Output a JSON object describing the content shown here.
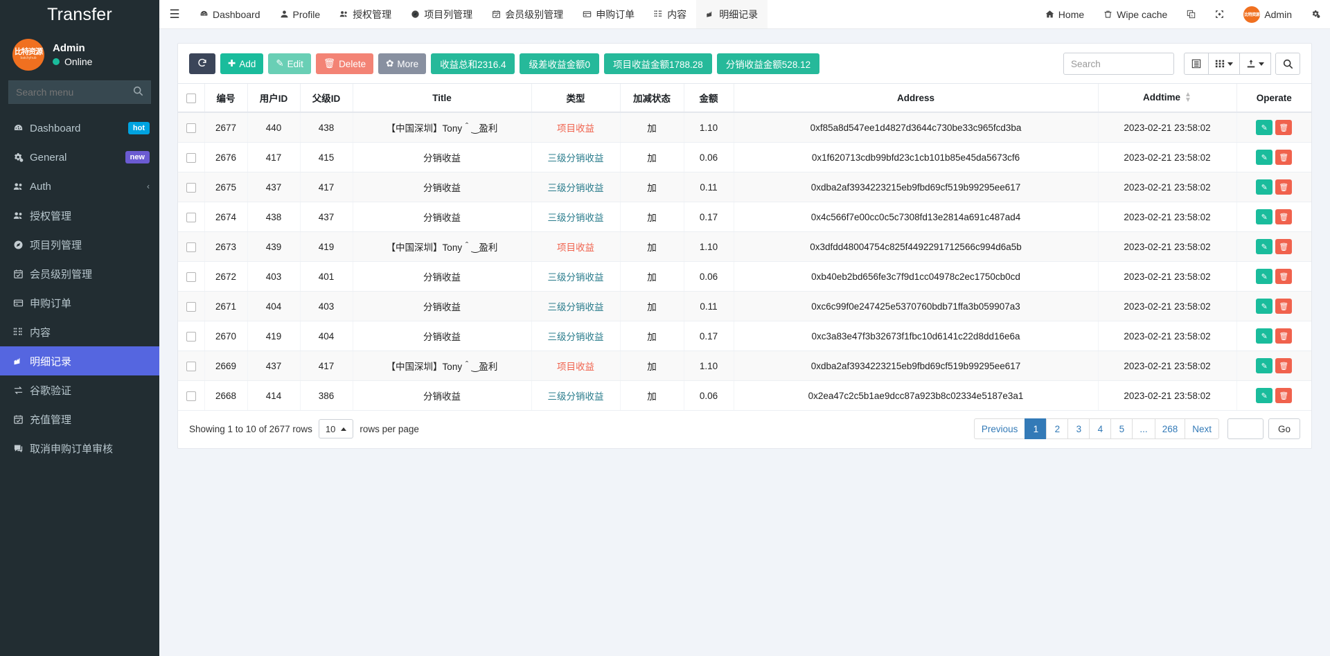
{
  "sidebar": {
    "brand": "Transfer",
    "user": {
      "name": "Admin",
      "status": "Online",
      "avatar_cn": "比特资源",
      "avatar_sub": "batchyhub"
    },
    "search_placeholder": "Search menu",
    "items": [
      {
        "label": "Dashboard",
        "icon": "dashboard-icon",
        "badge": "hot",
        "badge_type": "hot"
      },
      {
        "label": "General",
        "icon": "gears-icon",
        "badge": "new",
        "badge_type": "new"
      },
      {
        "label": "Auth",
        "icon": "users-icon",
        "chevron": "‹"
      },
      {
        "label": "授权管理",
        "icon": "users-icon"
      },
      {
        "label": "项目列管理",
        "icon": "compass-icon"
      },
      {
        "label": "会员级别管理",
        "icon": "calendar-check-icon"
      },
      {
        "label": "申购订单",
        "icon": "card-icon"
      },
      {
        "label": "内容",
        "icon": "th-icon"
      },
      {
        "label": "明细记录",
        "icon": "chart-icon",
        "active": true
      },
      {
        "label": "谷歌验证",
        "icon": "exchange-icon"
      },
      {
        "label": "充值管理",
        "icon": "calendar-check-icon"
      },
      {
        "label": "取消申购订单审核",
        "icon": "comment-icon"
      }
    ]
  },
  "topnav": {
    "hamburger": "☰",
    "left_items": [
      {
        "label": "Dashboard",
        "icon": "dashboard-icon"
      },
      {
        "label": "Profile",
        "icon": "user-icon"
      },
      {
        "label": "授权管理",
        "icon": "users-icon"
      },
      {
        "label": "项目列管理",
        "icon": "compass-icon"
      },
      {
        "label": "会员级别管理",
        "icon": "calendar-check-icon"
      },
      {
        "label": "申购订单",
        "icon": "card-icon"
      },
      {
        "label": "内容",
        "icon": "th-icon"
      },
      {
        "label": "明细记录",
        "icon": "chart-icon",
        "active": true
      }
    ],
    "right_items": [
      {
        "label": "Home",
        "icon": "home-icon"
      },
      {
        "label": "Wipe cache",
        "icon": "trash-icon"
      },
      {
        "label": "",
        "icon": "language-icon"
      },
      {
        "label": "",
        "icon": "fullscreen-icon"
      },
      {
        "label": "Admin",
        "icon": "avatar-icon"
      },
      {
        "label": "",
        "icon": "gear-icon"
      }
    ]
  },
  "toolbar": {
    "refresh_label": "↻",
    "add_label": "Add",
    "edit_label": "Edit",
    "delete_label": "Delete",
    "more_label": "More",
    "stats": [
      "收益总和2316.4",
      "级差收益金额0",
      "项目收益金额1788.28",
      "分销收益金额528.12"
    ],
    "search_placeholder": "Search",
    "columns_icon": "columns-icon",
    "grid_icon": "grid-icon",
    "export_icon": "export-icon",
    "search_icon": "search-icon"
  },
  "table": {
    "columns": [
      "",
      "编号",
      "用户ID",
      "父级ID",
      "Title",
      "类型",
      "加减状态",
      "金额",
      "Address",
      "Addtime",
      "Operate"
    ],
    "rows": [
      {
        "id": "2677",
        "uid": "440",
        "pid": "438",
        "title": "【中国深圳】Tony＾‿盈利",
        "type": "项目收益",
        "type_color": "red",
        "sign": "加",
        "amount": "1.10",
        "address": "0xf85a8d547ee1d4827d3644c730be33c965fcd3ba",
        "addtime": "2023-02-21 23:58:02"
      },
      {
        "id": "2676",
        "uid": "417",
        "pid": "415",
        "title": "分销收益",
        "type": "三级分销收益",
        "type_color": "teal",
        "sign": "加",
        "amount": "0.06",
        "address": "0x1f620713cdb99bfd23c1cb101b85e45da5673cf6",
        "addtime": "2023-02-21 23:58:02"
      },
      {
        "id": "2675",
        "uid": "437",
        "pid": "417",
        "title": "分销收益",
        "type": "三级分销收益",
        "type_color": "teal",
        "sign": "加",
        "amount": "0.11",
        "address": "0xdba2af3934223215eb9fbd69cf519b99295ee617",
        "addtime": "2023-02-21 23:58:02"
      },
      {
        "id": "2674",
        "uid": "438",
        "pid": "437",
        "title": "分销收益",
        "type": "三级分销收益",
        "type_color": "teal",
        "sign": "加",
        "amount": "0.17",
        "address": "0x4c566f7e00cc0c5c7308fd13e2814a691c487ad4",
        "addtime": "2023-02-21 23:58:02"
      },
      {
        "id": "2673",
        "uid": "439",
        "pid": "419",
        "title": "【中国深圳】Tony＾‿盈利",
        "type": "项目收益",
        "type_color": "red",
        "sign": "加",
        "amount": "1.10",
        "address": "0x3dfdd48004754c825f4492291712566c994d6a5b",
        "addtime": "2023-02-21 23:58:02"
      },
      {
        "id": "2672",
        "uid": "403",
        "pid": "401",
        "title": "分销收益",
        "type": "三级分销收益",
        "type_color": "teal",
        "sign": "加",
        "amount": "0.06",
        "address": "0xb40eb2bd656fe3c7f9d1cc04978c2ec1750cb0cd",
        "addtime": "2023-02-21 23:58:02"
      },
      {
        "id": "2671",
        "uid": "404",
        "pid": "403",
        "title": "分销收益",
        "type": "三级分销收益",
        "type_color": "teal",
        "sign": "加",
        "amount": "0.11",
        "address": "0xc6c99f0e247425e5370760bdb71ffa3b059907a3",
        "addtime": "2023-02-21 23:58:02"
      },
      {
        "id": "2670",
        "uid": "419",
        "pid": "404",
        "title": "分销收益",
        "type": "三级分销收益",
        "type_color": "teal",
        "sign": "加",
        "amount": "0.17",
        "address": "0xc3a83e47f3b32673f1fbc10d6141c22d8dd16e6a",
        "addtime": "2023-02-21 23:58:02"
      },
      {
        "id": "2669",
        "uid": "437",
        "pid": "417",
        "title": "【中国深圳】Tony＾‿盈利",
        "type": "项目收益",
        "type_color": "red",
        "sign": "加",
        "amount": "1.10",
        "address": "0xdba2af3934223215eb9fbd69cf519b99295ee617",
        "addtime": "2023-02-21 23:58:02"
      },
      {
        "id": "2668",
        "uid": "414",
        "pid": "386",
        "title": "分销收益",
        "type": "三级分销收益",
        "type_color": "teal",
        "sign": "加",
        "amount": "0.06",
        "address": "0x2ea47c2c5b1ae9dcc87a923b8c02334e5187e3a1",
        "addtime": "2023-02-21 23:58:02"
      }
    ]
  },
  "footer": {
    "showing_text": "Showing 1 to 10 of 2677 rows",
    "rows_per_page_value": "10",
    "rows_per_page_label": "rows per page",
    "pages": [
      "Previous",
      "1",
      "2",
      "3",
      "4",
      "5",
      "...",
      "268",
      "Next"
    ],
    "active_page": "1",
    "goto_value": "",
    "go_label": "Go"
  },
  "colors": {
    "sidebar_bg": "#222d32",
    "active_menu": "#5566e0",
    "primary_green": "#1abc9c",
    "danger": "#f0624d",
    "pager_active": "#337ab7"
  }
}
